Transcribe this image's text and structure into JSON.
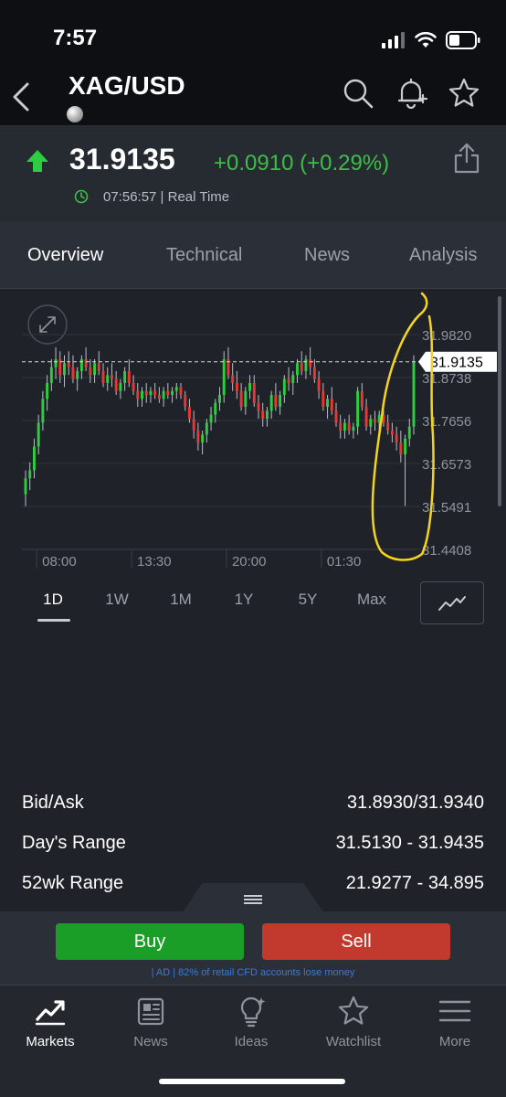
{
  "status": {
    "time": "7:57"
  },
  "header": {
    "symbol": "XAG/USD"
  },
  "quote": {
    "price": "31.9135",
    "change": "+0.0910 (+0.29%)",
    "timestamp": "07:56:57 | Real Time",
    "up_color": "#3cbf48"
  },
  "tabs": [
    "Overview",
    "Technical",
    "News",
    "Analysis"
  ],
  "chart_data": {
    "type": "candlestick",
    "y_ticks": [
      "31.9820",
      "31.8738",
      "31.7656",
      "31.6573",
      "31.5491",
      "31.4408"
    ],
    "x_ticks": [
      "08:00",
      "13:30",
      "20:00",
      "01:30"
    ],
    "current_price_label": "31.9135",
    "ylim": [
      31.4408,
      31.982
    ],
    "up_color": "#2ecc40",
    "down_color": "#e53935",
    "annotation": "yellow hand-drawn ellipse around latest candles",
    "candles": [
      [
        31.58,
        31.64,
        31.55,
        31.62
      ],
      [
        31.62,
        31.66,
        31.59,
        31.64
      ],
      [
        31.64,
        31.72,
        31.62,
        31.7
      ],
      [
        31.7,
        31.78,
        31.68,
        31.76
      ],
      [
        31.76,
        31.84,
        31.74,
        31.82
      ],
      [
        31.82,
        31.88,
        31.79,
        31.86
      ],
      [
        31.86,
        31.92,
        31.84,
        31.9
      ],
      [
        31.9,
        31.95,
        31.87,
        31.92
      ],
      [
        31.92,
        31.94,
        31.86,
        31.88
      ],
      [
        31.88,
        31.93,
        31.85,
        31.91
      ],
      [
        31.91,
        31.94,
        31.88,
        31.9
      ],
      [
        31.9,
        31.93,
        31.86,
        31.87
      ],
      [
        31.87,
        31.9,
        31.84,
        31.89
      ],
      [
        31.89,
        31.93,
        31.87,
        31.92
      ],
      [
        31.92,
        31.95,
        31.89,
        31.9
      ],
      [
        31.9,
        31.92,
        31.86,
        31.88
      ],
      [
        31.88,
        31.92,
        31.86,
        31.91
      ],
      [
        31.91,
        31.94,
        31.88,
        31.89
      ],
      [
        31.89,
        31.91,
        31.85,
        31.86
      ],
      [
        31.86,
        31.9,
        31.84,
        31.88
      ],
      [
        31.88,
        31.91,
        31.85,
        31.87
      ],
      [
        31.87,
        31.89,
        31.83,
        31.84
      ],
      [
        31.84,
        31.87,
        31.82,
        31.86
      ],
      [
        31.86,
        31.9,
        31.84,
        31.89
      ],
      [
        31.89,
        31.92,
        31.85,
        31.86
      ],
      [
        31.86,
        31.88,
        31.83,
        31.84
      ],
      [
        31.84,
        31.86,
        31.8,
        31.82
      ],
      [
        31.82,
        31.85,
        31.8,
        31.84
      ],
      [
        31.84,
        31.86,
        31.81,
        31.83
      ],
      [
        31.83,
        31.85,
        31.81,
        31.84
      ],
      [
        31.84,
        31.86,
        31.82,
        31.83
      ],
      [
        31.83,
        31.85,
        31.81,
        31.82
      ],
      [
        31.82,
        31.85,
        31.8,
        31.84
      ],
      [
        31.84,
        31.86,
        31.82,
        31.83
      ],
      [
        31.83,
        31.85,
        31.81,
        31.84
      ],
      [
        31.84,
        31.86,
        31.82,
        31.85
      ],
      [
        31.85,
        31.86,
        31.82,
        31.83
      ],
      [
        31.83,
        31.84,
        31.79,
        31.8
      ],
      [
        31.8,
        31.82,
        31.76,
        31.77
      ],
      [
        31.77,
        31.79,
        31.72,
        31.74
      ],
      [
        31.74,
        31.76,
        31.69,
        31.71
      ],
      [
        31.71,
        31.74,
        31.68,
        31.73
      ],
      [
        31.73,
        31.77,
        31.71,
        31.76
      ],
      [
        31.76,
        31.8,
        31.74,
        31.78
      ],
      [
        31.78,
        31.82,
        31.76,
        31.81
      ],
      [
        31.81,
        31.85,
        31.79,
        31.83
      ],
      [
        31.83,
        31.94,
        31.81,
        31.92
      ],
      [
        31.92,
        31.95,
        31.87,
        31.88
      ],
      [
        31.88,
        31.91,
        31.84,
        31.86
      ],
      [
        31.86,
        31.89,
        31.82,
        31.84
      ],
      [
        31.84,
        31.86,
        31.79,
        31.8
      ],
      [
        31.8,
        31.85,
        31.78,
        31.84
      ],
      [
        31.84,
        31.88,
        31.82,
        31.86
      ],
      [
        31.86,
        31.88,
        31.8,
        31.81
      ],
      [
        31.81,
        31.83,
        31.77,
        31.79
      ],
      [
        31.79,
        31.81,
        31.75,
        31.77
      ],
      [
        31.77,
        31.8,
        31.75,
        31.79
      ],
      [
        31.79,
        31.84,
        31.77,
        31.83
      ],
      [
        31.83,
        31.86,
        31.79,
        31.8
      ],
      [
        31.8,
        31.84,
        31.78,
        31.83
      ],
      [
        31.83,
        31.88,
        31.81,
        31.87
      ],
      [
        31.87,
        31.9,
        31.84,
        31.86
      ],
      [
        31.86,
        31.89,
        31.83,
        31.88
      ],
      [
        31.88,
        31.92,
        31.86,
        31.91
      ],
      [
        31.91,
        31.94,
        31.88,
        31.89
      ],
      [
        31.89,
        31.93,
        31.87,
        31.92
      ],
      [
        31.92,
        31.95,
        31.88,
        31.9
      ],
      [
        31.9,
        31.92,
        31.86,
        31.87
      ],
      [
        31.87,
        31.89,
        31.82,
        31.84
      ],
      [
        31.84,
        31.86,
        31.79,
        31.8
      ],
      [
        31.8,
        31.83,
        31.77,
        31.82
      ],
      [
        31.82,
        31.85,
        31.78,
        31.79
      ],
      [
        31.79,
        31.81,
        31.75,
        31.76
      ],
      [
        31.76,
        31.78,
        31.72,
        31.74
      ],
      [
        31.74,
        31.77,
        31.72,
        31.76
      ],
      [
        31.76,
        31.78,
        31.73,
        31.74
      ],
      [
        31.74,
        31.76,
        31.72,
        31.75
      ],
      [
        31.75,
        31.85,
        31.73,
        31.84
      ],
      [
        31.84,
        31.86,
        31.79,
        31.8
      ],
      [
        31.8,
        31.82,
        31.74,
        31.75
      ],
      [
        31.75,
        31.78,
        31.73,
        31.77
      ],
      [
        31.77,
        31.79,
        31.74,
        31.76
      ],
      [
        31.76,
        31.79,
        31.74,
        31.78
      ],
      [
        31.78,
        31.8,
        31.75,
        31.76
      ],
      [
        31.76,
        31.78,
        31.73,
        31.74
      ],
      [
        31.74,
        31.76,
        31.71,
        31.73
      ],
      [
        31.73,
        31.75,
        31.69,
        31.71
      ],
      [
        31.71,
        31.74,
        31.66,
        31.68
      ],
      [
        31.68,
        31.73,
        31.55,
        31.72
      ],
      [
        31.72,
        31.77,
        31.7,
        31.75
      ],
      [
        31.75,
        31.93,
        31.73,
        31.9135
      ]
    ]
  },
  "ranges": [
    "1D",
    "1W",
    "1M",
    "1Y",
    "5Y",
    "Max"
  ],
  "stats": [
    {
      "label": "Bid/Ask",
      "value": "31.8930/31.9340"
    },
    {
      "label": "Day's Range",
      "value": "31.5130 - 31.9435"
    },
    {
      "label": "52wk Range",
      "value": "21.9277 - 34.895"
    }
  ],
  "trade": {
    "buy_label": "Buy",
    "sell_label": "Sell",
    "disclaimer": "| AD | 82% of retail CFD accounts lose money",
    "buy_color": "#1a9e28",
    "sell_color": "#c23a2e"
  },
  "nav": [
    {
      "label": "Markets",
      "icon": "markets-icon"
    },
    {
      "label": "News",
      "icon": "news-icon"
    },
    {
      "label": "Ideas",
      "icon": "ideas-icon"
    },
    {
      "label": "Watchlist",
      "icon": "watchlist-icon"
    },
    {
      "label": "More",
      "icon": "more-icon"
    }
  ]
}
